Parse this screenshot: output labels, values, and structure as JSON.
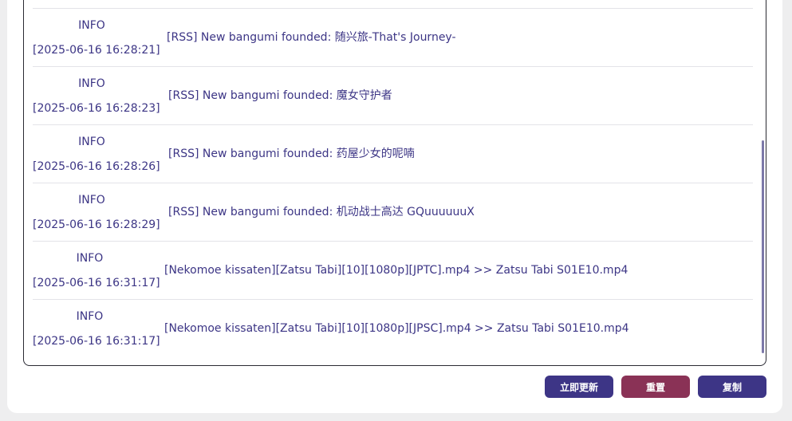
{
  "logs": [
    {
      "level": "",
      "time": "",
      "message": ""
    },
    {
      "level": "INFO",
      "time": "[2025-06-16 16:28:21]",
      "message": "[RSS] New bangumi founded: 随兴旅-That's Journey-"
    },
    {
      "level": "INFO",
      "time": "[2025-06-16 16:28:23]",
      "message": "[RSS] New bangumi founded: 魔女守护者"
    },
    {
      "level": "INFO",
      "time": "[2025-06-16 16:28:26]",
      "message": "[RSS] New bangumi founded: 药屋少女的呢喃"
    },
    {
      "level": "INFO",
      "time": "[2025-06-16 16:28:29]",
      "message": "[RSS] New bangumi founded: 机动战士高达 GQuuuuuuX"
    },
    {
      "level": "INFO",
      "time": "[2025-06-16 16:31:17]",
      "message": "[Nekomoe kissaten][Zatsu Tabi][10][1080p][JPTC].mp4 >> Zatsu Tabi S01E10.mp4"
    },
    {
      "level": "INFO",
      "time": "[2025-06-16 16:31:17]",
      "message": "[Nekomoe kissaten][Zatsu Tabi][10][1080p][JPSC].mp4 >> Zatsu Tabi S01E10.mp4"
    }
  ],
  "buttons": {
    "update_label": "立即更新",
    "reset_label": "重置",
    "copy_label": "复制"
  },
  "colors": {
    "primary": "#3d3586",
    "danger": "#8a3256",
    "log_text": "#3c3585"
  }
}
